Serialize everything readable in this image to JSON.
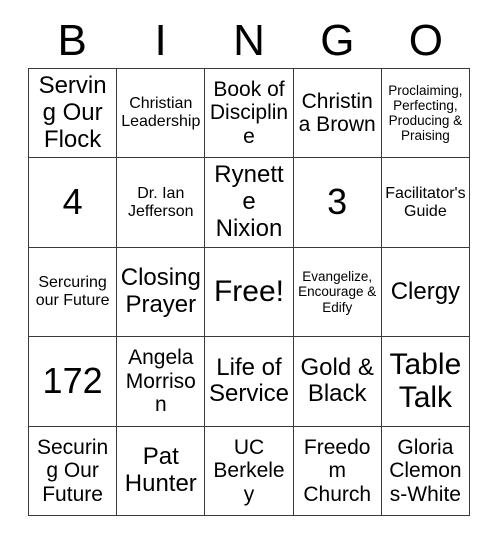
{
  "card": {
    "header": {
      "letters": [
        "B",
        "I",
        "N",
        "G",
        "O"
      ]
    },
    "rows": [
      {
        "cells": [
          {
            "text": "Serving Our Flock",
            "size": "lg"
          },
          {
            "text": "Christian Leadership",
            "size": "sm"
          },
          {
            "text": "Book of Discipline",
            "size": "md"
          },
          {
            "text": "Christina Brown",
            "size": "md"
          },
          {
            "text": "Proclaiming, Perfecting, Producing & Praising",
            "size": "xs"
          }
        ]
      },
      {
        "cells": [
          {
            "text": "4",
            "size": "xxl"
          },
          {
            "text": "Dr. Ian Jefferson",
            "size": "sm"
          },
          {
            "text": "Rynette Nixion",
            "size": "lg"
          },
          {
            "text": "3",
            "size": "xxl"
          },
          {
            "text": "Facilitator's Guide",
            "size": "sm"
          }
        ]
      },
      {
        "cells": [
          {
            "text": "Sercuring our Future",
            "size": "sm"
          },
          {
            "text": "Closing Prayer",
            "size": "lg"
          },
          {
            "text": "Free!",
            "size": "xl"
          },
          {
            "text": "Evangelize, Encourage & Edify",
            "size": "xs"
          },
          {
            "text": "Clergy",
            "size": "lg"
          }
        ]
      },
      {
        "cells": [
          {
            "text": "172",
            "size": "xxl"
          },
          {
            "text": "Angela Morrison",
            "size": "md"
          },
          {
            "text": "Life of Service",
            "size": "lg"
          },
          {
            "text": "Gold & Black",
            "size": "lg"
          },
          {
            "text": "Table Talk",
            "size": "xl"
          }
        ]
      },
      {
        "cells": [
          {
            "text": "Securing Our Future",
            "size": "md"
          },
          {
            "text": "Pat Hunter",
            "size": "lg"
          },
          {
            "text": "UC Berkeley",
            "size": "md"
          },
          {
            "text": "Freedom Church",
            "size": "md"
          },
          {
            "text": "Gloria Clemons-White",
            "size": "md"
          }
        ]
      }
    ]
  },
  "colors": {
    "grid_line": "#3a3a3a",
    "text": "#000000",
    "background": "#ffffff"
  }
}
